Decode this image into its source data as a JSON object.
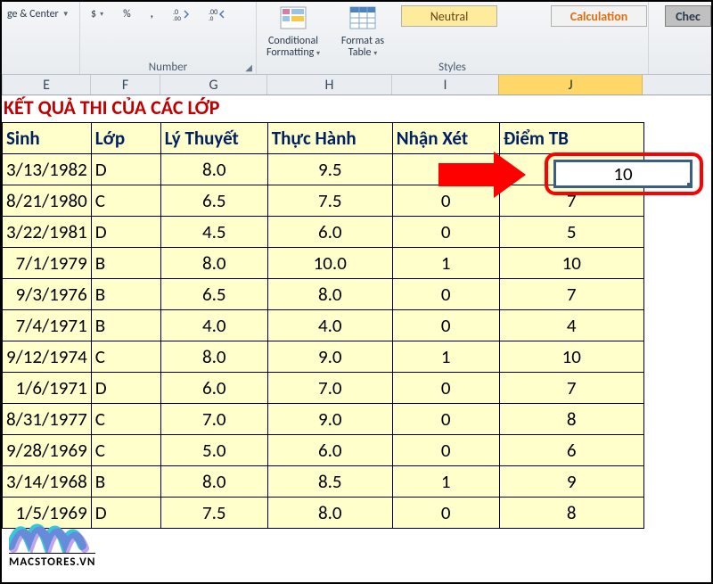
{
  "ribbon": {
    "merge_center": "ge & Center",
    "number_group": "Number",
    "number_symbols": {
      "dollar": "$",
      "percent": "%",
      "comma": ",",
      "inc_dec": "Increase/Decrease Decimal"
    },
    "formatting": {
      "conditional": "Conditional",
      "conditional2": "Formatting",
      "formatas": "Format as",
      "table": "Table"
    },
    "style_chips": {
      "neutral": "Neutral",
      "calculation": "Calculation",
      "check": "Chec"
    },
    "styles_group": "Styles"
  },
  "columns": [
    "E",
    "F",
    "G",
    "H",
    "I",
    "J"
  ],
  "active_column_index": 5,
  "worksheet": {
    "title": "KẾT QUẢ THI CỦA CÁC LỚP",
    "headers": {
      "sinh": "Sinh",
      "lop": "Lớp",
      "lythuyet": "Lý Thuyết",
      "thuchanh": "Thực Hành",
      "nhanxet": "Nhận Xét",
      "diemtb": "Điểm TB"
    },
    "rows": [
      {
        "sinh": "3/13/1982",
        "lop": "D",
        "lt": "8.0",
        "th": "9.5",
        "nx": "",
        "tb": "10"
      },
      {
        "sinh": "8/21/1980",
        "lop": "C",
        "lt": "6.5",
        "th": "7.5",
        "nx": "0",
        "tb": "7"
      },
      {
        "sinh": "3/22/1981",
        "lop": "D",
        "lt": "4.5",
        "th": "6.0",
        "nx": "0",
        "tb": "5"
      },
      {
        "sinh": "7/1/1979",
        "lop": "B",
        "lt": "8.0",
        "th": "10.0",
        "nx": "1",
        "tb": "10"
      },
      {
        "sinh": "9/3/1976",
        "lop": "B",
        "lt": "6.5",
        "th": "8.0",
        "nx": "0",
        "tb": "7"
      },
      {
        "sinh": "7/4/1971",
        "lop": "B",
        "lt": "4.0",
        "th": "4.0",
        "nx": "0",
        "tb": "4"
      },
      {
        "sinh": "9/12/1974",
        "lop": "C",
        "lt": "8.0",
        "th": "9.0",
        "nx": "1",
        "tb": "10"
      },
      {
        "sinh": "1/6/1971",
        "lop": "D",
        "lt": "6.0",
        "th": "7.0",
        "nx": "0",
        "tb": "7"
      },
      {
        "sinh": "8/31/1977",
        "lop": "C",
        "lt": "7.0",
        "th": "9.0",
        "nx": "0",
        "tb": "8"
      },
      {
        "sinh": "9/28/1969",
        "lop": "C",
        "lt": "5.0",
        "th": "6.0",
        "nx": "0",
        "tb": "6"
      },
      {
        "sinh": "3/14/1968",
        "lop": "B",
        "lt": "8.0",
        "th": "8.5",
        "nx": "1",
        "tb": "9"
      },
      {
        "sinh": "1/5/1969",
        "lop": "D",
        "lt": "7.5",
        "th": "8.0",
        "nx": "0",
        "tb": "8"
      }
    ],
    "active_cell_value": "10"
  },
  "watermark": "MACSTORES.VN"
}
